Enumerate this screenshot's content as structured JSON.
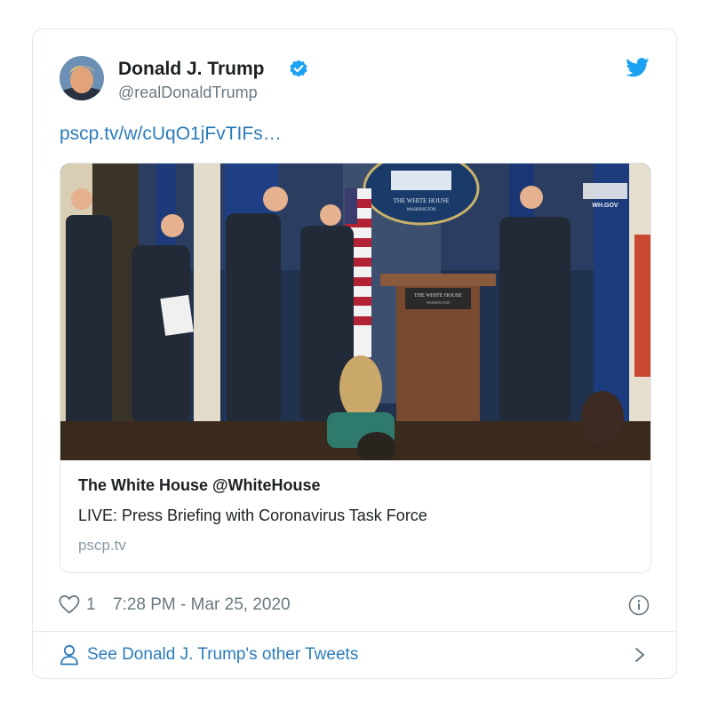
{
  "author": {
    "name": "Donald J. Trump",
    "handle": "@realDonaldTrump"
  },
  "tweet": {
    "link_text": "pscp.tv/w/cUqO1jFvTIFs…"
  },
  "media_card": {
    "title": "The White House @WhiteHouse",
    "description": "LIVE: Press Briefing with Coronavirus Task Force",
    "domain": "pscp.tv",
    "image_texts": {
      "seal_top": "THE WHITE HOUSE",
      "seal_bottom": "WASHINGTON",
      "podium_line1": "THE WHITE HOUSE",
      "podium_line2": "WASHINGTON",
      "watermark": "WH.GOV"
    }
  },
  "footer": {
    "like_count": "1",
    "timestamp": "7:28 PM - Mar 25, 2020",
    "see_more": "See Donald J. Trump's other Tweets"
  },
  "icons": {
    "brand": "twitter-bird-icon",
    "verified": "verified-badge-icon",
    "like": "heart-icon",
    "info": "info-icon",
    "profile": "person-icon",
    "more": "chevron-right-icon"
  },
  "colors": {
    "accent": "#1da1f2",
    "link": "#2b7bb9",
    "muted": "#697882",
    "border": "#e1e8ed"
  }
}
